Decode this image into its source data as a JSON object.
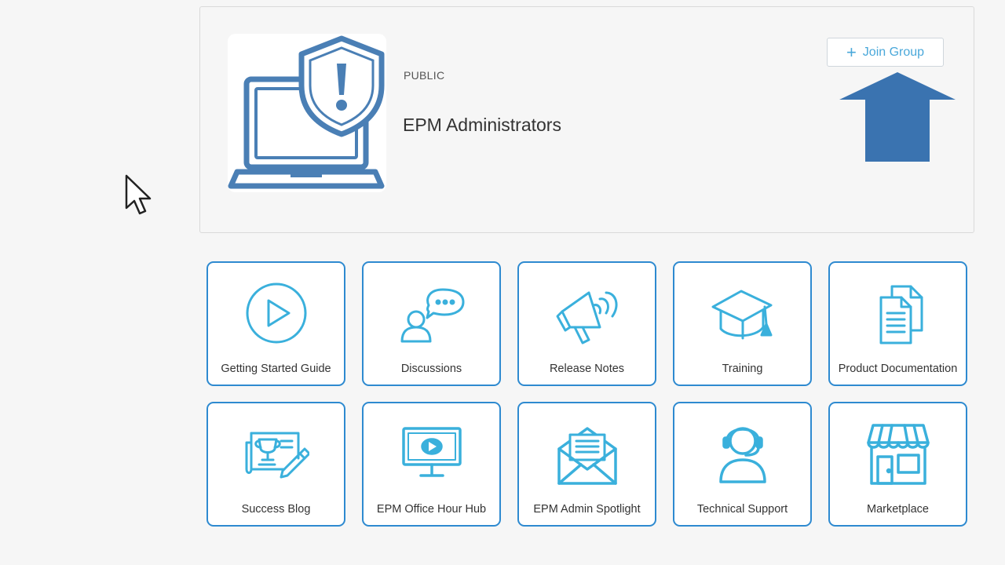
{
  "group": {
    "visibility": "PUBLIC",
    "title": "EPM Administrators",
    "join_label": "Join Group"
  },
  "tiles": [
    {
      "label": "Getting Started Guide",
      "icon": "play-circle-icon"
    },
    {
      "label": "Discussions",
      "icon": "discussion-icon"
    },
    {
      "label": "Release Notes",
      "icon": "megaphone-icon"
    },
    {
      "label": "Training",
      "icon": "graduation-cap-icon"
    },
    {
      "label": "Product Documentation",
      "icon": "documents-icon"
    },
    {
      "label": "Success Blog",
      "icon": "blog-trophy-icon"
    },
    {
      "label": "EPM Office Hour Hub",
      "icon": "monitor-play-icon"
    },
    {
      "label": "EPM Admin Spotlight",
      "icon": "envelope-letter-icon"
    },
    {
      "label": "Technical Support",
      "icon": "headset-support-icon"
    },
    {
      "label": "Marketplace",
      "icon": "storefront-icon"
    }
  ],
  "colors": {
    "accent": "#2e8ad0",
    "icon": "#3ab0dc",
    "arrow": "#3a73b0",
    "logo": "#4a7fb5",
    "join_text": "#4aa8da"
  }
}
